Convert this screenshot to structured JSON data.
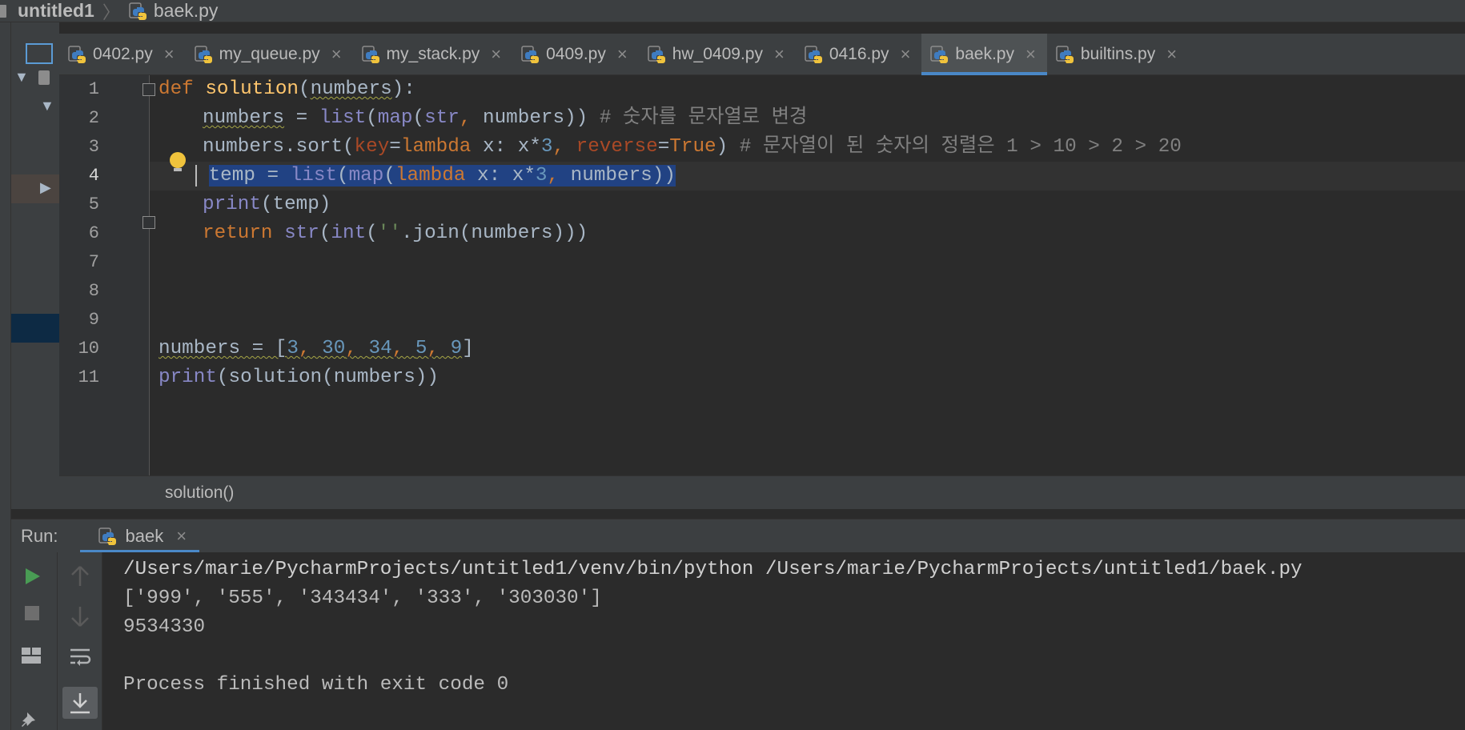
{
  "navbar": {
    "project": "untitled1",
    "separator": "〉",
    "file": "baek.py"
  },
  "tabs": [
    {
      "label": "0402.py",
      "icon": "python-file-icon",
      "active": false
    },
    {
      "label": "my_queue.py",
      "icon": "python-file-icon",
      "active": false
    },
    {
      "label": "my_stack.py",
      "icon": "python-file-icon",
      "active": false
    },
    {
      "label": "0409.py",
      "icon": "python-file-icon",
      "active": false
    },
    {
      "label": "hw_0409.py",
      "icon": "python-file-icon",
      "active": false
    },
    {
      "label": "0416.py",
      "icon": "python-file-icon",
      "active": false
    },
    {
      "label": "baek.py",
      "icon": "python-file-icon",
      "active": true
    },
    {
      "label": "builtins.py",
      "icon": "python-file-icon",
      "active": false
    }
  ],
  "tab_close_glyph": "×",
  "editor": {
    "line_numbers": [
      "1",
      "2",
      "3",
      "4",
      "5",
      "6",
      "7",
      "8",
      "9",
      "10",
      "11"
    ],
    "current_line": "4",
    "code": {
      "l1": {
        "kw": "def",
        "fn": "solution",
        "p1": "(",
        "param": "numbers",
        "p2": "):"
      },
      "l2": {
        "var": "numbers",
        "eq": " = ",
        "list": "list",
        "p1": "(",
        "map": "map",
        "p2": "(",
        "str": "str",
        "comma": ", ",
        "arg": "numbers",
        "p3": "))",
        "cm": " # 숫자를 문자열로 변경"
      },
      "l3": {
        "a": "numbers.sort(",
        "key": "key",
        "eq": "=",
        "lam": "lambda",
        "b": " x: x*",
        "n": "3",
        "c": ", ",
        "rev": "reverse",
        "eq2": "=",
        "tr": "True",
        "d": ")",
        "cm": " # 문자열이 된 숫자의 정렬은 1 > 10 > 2 > 20"
      },
      "l4": {
        "a": "temp = ",
        "list": "list",
        "p1": "(",
        "map": "map",
        "p2": "(",
        "lam": "lambda",
        "b": " x: x*",
        "n": "3",
        "c": ", ",
        "d": "numbers))"
      },
      "l5": {
        "print": "print",
        "a": "(temp)"
      },
      "l6": {
        "ret": "return",
        "sp": " ",
        "str": "str",
        "p1": "(",
        "int": "int",
        "p2": "(",
        "s": "''",
        "a": ".join(numbers)))"
      },
      "l10": {
        "a": "numbers = [",
        "n1": "3",
        "n2": "30",
        "n3": "34",
        "n4": "5",
        "n5": "9",
        "sep": ", ",
        "b": "]"
      },
      "l11": {
        "print": "print",
        "a": "(solution(numbers))"
      }
    }
  },
  "editor_breadcrumb": "solution()",
  "run": {
    "label": "Run:",
    "tab_label": "baek",
    "output": [
      "/Users/marie/PycharmProjects/untitled1/venv/bin/python /Users/marie/PycharmProjects/untitled1/baek.py",
      "['999', '555', '343434', '333', '303030']",
      "9534330",
      "",
      "Process finished with exit code 0"
    ]
  },
  "colors": {
    "background": "#2b2b2b",
    "panel": "#3c3f41",
    "accent": "#4a88c7",
    "keyword": "#cc7832",
    "function": "#ffc66d",
    "builtin": "#8888c6",
    "number": "#6897bb",
    "comment": "#808080",
    "run_green": "#499c54"
  }
}
